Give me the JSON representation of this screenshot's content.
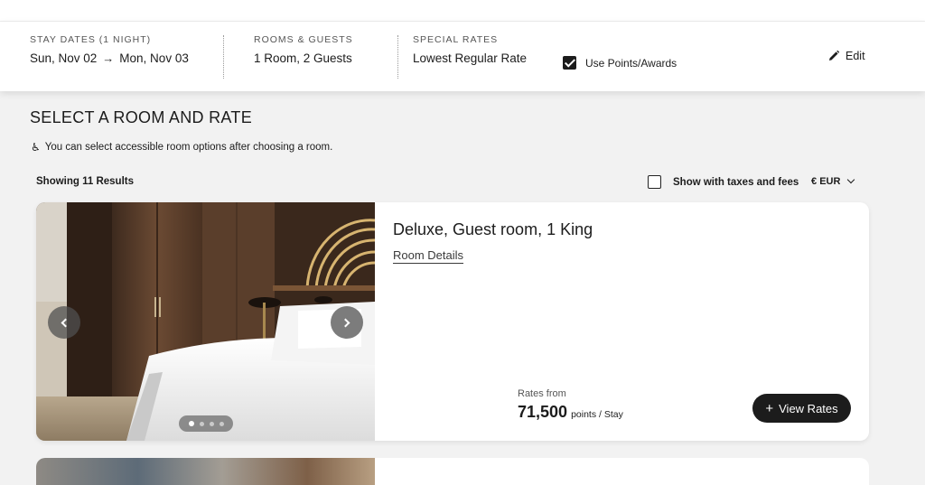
{
  "stay_bar": {
    "dates_label": "STAY DATES (1 NIGHT)",
    "check_in": "Sun, Nov 02",
    "arrow": "→",
    "check_out": "Mon, Nov 03",
    "rooms_label": "ROOMS & GUESTS",
    "rooms_value": "1 Room, 2 Guests",
    "rates_label": "SPECIAL RATES",
    "rates_value": "Lowest Regular Rate",
    "use_points_label": "Use Points/Awards",
    "use_points_checked": true,
    "edit_label": "Edit"
  },
  "page": {
    "title": "SELECT A ROOM AND RATE",
    "accessibility_note": "You can select accessible room options after choosing a room."
  },
  "results": {
    "count_label": "Showing 11 Results",
    "taxes_label": "Show with taxes and fees",
    "taxes_checked": false,
    "currency_symbol": "€",
    "currency_code": "EUR"
  },
  "rooms": [
    {
      "name": "Deluxe, Guest room, 1 King",
      "details_link": "Room Details",
      "rates_from_label": "Rates from",
      "points": "71,500",
      "points_unit": "points / Stay",
      "view_rates_label": "View Rates",
      "photo_count": 4,
      "active_photo": 1
    }
  ],
  "icons": {
    "edit": "pencil-icon",
    "accessibility": "wheelchair-icon",
    "currency_dropdown": "chevron-down-icon",
    "prev": "chevron-left-icon",
    "next": "chevron-right-icon",
    "view_rates": "plus-icon"
  },
  "colors": {
    "primary_button": "#1c1c1c",
    "page_background": "#f2f2f2"
  }
}
